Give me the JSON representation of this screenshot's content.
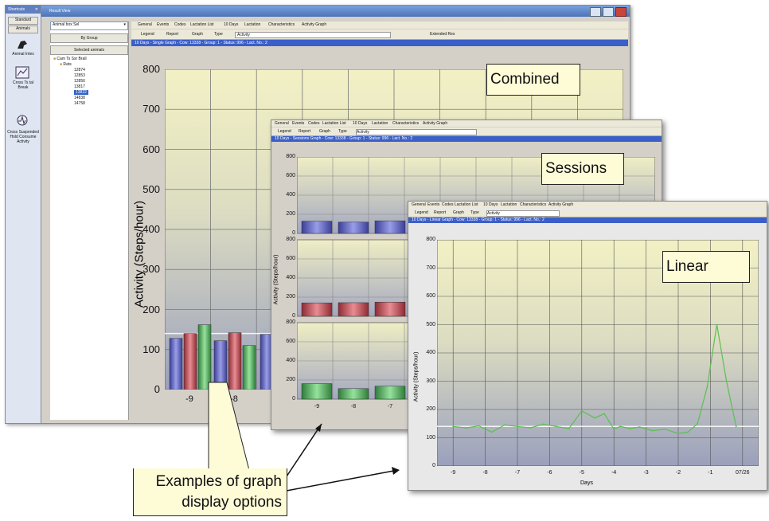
{
  "main": {
    "title": "Result View",
    "dock_title": "Shortcuts",
    "dock_tabs": [
      "Standard",
      "Animals"
    ],
    "dock_items": [
      "Animal Intes",
      "Cross Ts tal Break",
      "Cross Suspended Hold Consume Activity"
    ],
    "dropdown": "Animal box Sel",
    "by_group": "By Group",
    "selected_animals": "Selected animals",
    "tree_root": "Cam Ts Ssr Brall",
    "tree_folder": "Rats",
    "tree_items": [
      "12874",
      "12853",
      "12856",
      "13817",
      "13822",
      "14838",
      "14758"
    ],
    "selected_item": "13822",
    "tabs": [
      "General",
      "Events",
      "Codes",
      "Lactation List",
      "10 Days",
      "Lactation",
      "Characteristics",
      "Activity Graph"
    ],
    "toolbar": [
      "Legend",
      "Report",
      "Graph",
      "Type",
      "Activity"
    ],
    "toolbar_right": "Extended Res",
    "info_bar": "10 Days - Single Graph - Cow: 13338 - Group: 1 - Status: 996 - Lact. No.: 2"
  },
  "sessions_window": {
    "tabs": [
      "General",
      "Events",
      "Codes",
      "Lactation List",
      "10 Days",
      "Lactation",
      "Characteristics",
      "Activity Graph"
    ],
    "info_bar": "10 Days - Sessions Graph - Cow: 13338 - Group: 1 - Status: 996 - Lact. No.: 2",
    "ylabel": "Activity (Steps/hour)"
  },
  "linear_window": {
    "tabs": [
      "General",
      "Events",
      "Codes",
      "Lactation List",
      "10 Days",
      "Lactation",
      "Characteristics",
      "Activity Graph"
    ],
    "info_bar": "10 Days - Linear Graph - Cow: 13338 - Group: 1 - Status: 996 - Lact. No.: 2"
  },
  "callouts": {
    "combined": "Combined",
    "sessions": "Sessions",
    "linear": "Linear",
    "examples_line1": "Examples of graph",
    "examples_line2": "display options"
  },
  "colors": {
    "blue_bar": "#5a5fb8",
    "red_bar": "#b84a52",
    "green_bar": "#4fa85a",
    "line": "#5cbf52",
    "info_bar": "#3b5fc8"
  },
  "chart_data": [
    {
      "type": "bar",
      "title": "Combined",
      "ylabel": "Activity (Steps/hour)",
      "ylim": [
        0,
        800
      ],
      "yticks": [
        0,
        100,
        200,
        300,
        400,
        500,
        600,
        700,
        800
      ],
      "categories": [
        "-9",
        "-8"
      ],
      "series": [
        {
          "values": [
            128,
            122
          ]
        },
        {
          "values": [
            140,
            142
          ]
        },
        {
          "values": [
            162,
            110
          ]
        }
      ],
      "extra_bar": 138,
      "grid": true
    },
    {
      "type": "bar",
      "title": "Sessions",
      "panels": [
        {
          "ylim": [
            0,
            800
          ],
          "yticks": [
            0,
            200,
            400,
            600,
            800
          ],
          "values": [
            128,
            118,
            132
          ],
          "color": "blue"
        },
        {
          "ylim": [
            0,
            800
          ],
          "yticks": [
            0,
            200,
            400,
            600,
            800
          ],
          "values": [
            140,
            142,
            148
          ],
          "color": "red"
        },
        {
          "ylim": [
            0,
            800
          ],
          "yticks": [
            0,
            200,
            400,
            600,
            800
          ],
          "values": [
            162,
            110,
            135
          ],
          "color": "green"
        }
      ],
      "categories": [
        "-9",
        "-8",
        "-7"
      ]
    },
    {
      "type": "line",
      "title": "Linear",
      "xlabel": "Days",
      "ylabel": "Activity (Steps/hour)",
      "ylim": [
        0,
        800
      ],
      "yticks": [
        0,
        100,
        200,
        300,
        400,
        500,
        600,
        700,
        800
      ],
      "xticks": [
        "-9",
        "-8",
        "-7",
        "-6",
        "-5",
        "-4",
        "-3",
        "-2",
        "-1",
        "07/26"
      ],
      "x": [
        -9,
        -8.6,
        -8.2,
        -7.8,
        -7.4,
        -7,
        -6.6,
        -6.2,
        -5.8,
        -5.4,
        -5,
        -4.6,
        -4.3,
        -4,
        -3.8,
        -3.5,
        -3.2,
        -2.8,
        -2.4,
        -2,
        -1.7,
        -1.4,
        -1.1,
        -0.8,
        -0.5,
        -0.2
      ],
      "y": [
        140,
        135,
        142,
        120,
        145,
        140,
        135,
        148,
        140,
        132,
        195,
        170,
        185,
        130,
        140,
        132,
        138,
        125,
        130,
        115,
        120,
        150,
        280,
        500,
        300,
        140
      ],
      "baseline": 140,
      "grid": true
    }
  ]
}
